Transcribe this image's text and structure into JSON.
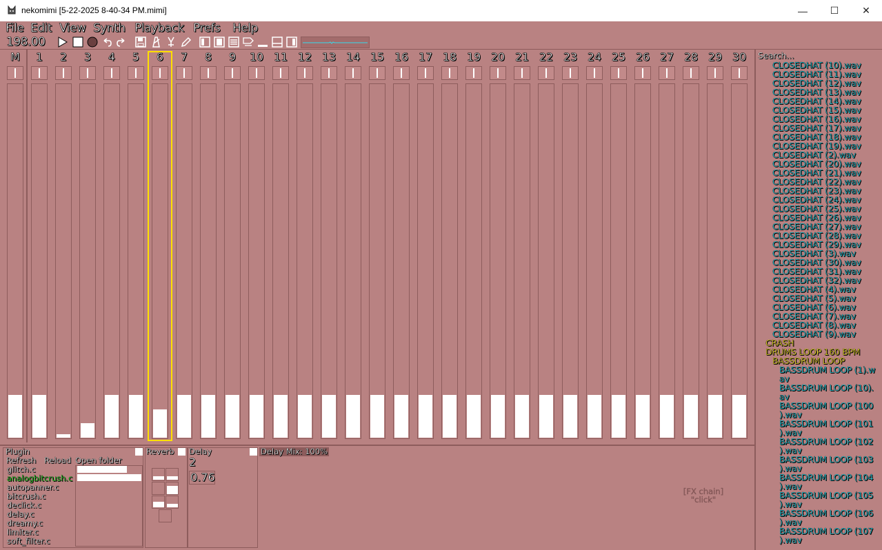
{
  "window": {
    "title": "nekomimi [5-22-2025 8-40-34 PM.mimi]",
    "minimize": "—",
    "maximize": "☐",
    "close": "✕"
  },
  "menu": [
    "File",
    "Edit",
    "View",
    "Synth",
    "Playback",
    "Prefs",
    "Help"
  ],
  "toolbar": {
    "bpm": "198.00",
    "icons": [
      "play-icon",
      "stop-icon",
      "record-icon",
      "undo-icon",
      "redo-icon",
      "save-icon",
      "metronome-icon",
      "tuner-icon",
      "pencil-icon",
      "layout-a-icon",
      "layout-b-icon",
      "layout-c-icon",
      "notes-icon",
      "layout-d-icon",
      "layout-e-icon",
      "layout-f-icon"
    ]
  },
  "mixer": {
    "channels": [
      "M",
      "1",
      "2",
      "3",
      "4",
      "5",
      "6",
      "7",
      "8",
      "9",
      "10",
      "11",
      "12",
      "13",
      "14",
      "15",
      "16",
      "17",
      "18",
      "19",
      "20",
      "21",
      "22",
      "23",
      "24",
      "25",
      "26",
      "27",
      "28",
      "29",
      "30"
    ],
    "levels": [
      0.12,
      0.12,
      0.01,
      0.04,
      0.12,
      0.12,
      0.08,
      0.12,
      0.12,
      0.12,
      0.12,
      0.12,
      0.12,
      0.12,
      0.12,
      0.12,
      0.12,
      0.12,
      0.12,
      0.12,
      0.12,
      0.12,
      0.12,
      0.12,
      0.12,
      0.12,
      0.12,
      0.12,
      0.12,
      0.12,
      0.12
    ],
    "selected_channel": "6"
  },
  "browser": {
    "search_label": "Search...",
    "items": [
      {
        "text": "CLOSEDHAT (10).wav",
        "type": "file",
        "indent": 2
      },
      {
        "text": "CLOSEDHAT (11).wav",
        "type": "file",
        "indent": 2
      },
      {
        "text": "CLOSEDHAT (12).wav",
        "type": "file",
        "indent": 2
      },
      {
        "text": "CLOSEDHAT (13).wav",
        "type": "file",
        "indent": 2
      },
      {
        "text": "CLOSEDHAT (14).wav",
        "type": "file",
        "indent": 2
      },
      {
        "text": "CLOSEDHAT (15).wav",
        "type": "file",
        "indent": 2
      },
      {
        "text": "CLOSEDHAT (16).wav",
        "type": "file",
        "indent": 2
      },
      {
        "text": "CLOSEDHAT (17).wav",
        "type": "file",
        "indent": 2
      },
      {
        "text": "CLOSEDHAT (18).wav",
        "type": "file",
        "indent": 2
      },
      {
        "text": "CLOSEDHAT (19).wav",
        "type": "file",
        "indent": 2
      },
      {
        "text": "CLOSEDHAT (2).wav",
        "type": "file",
        "indent": 2
      },
      {
        "text": "CLOSEDHAT (20).wav",
        "type": "file",
        "indent": 2
      },
      {
        "text": "CLOSEDHAT (21).wav",
        "type": "file",
        "indent": 2
      },
      {
        "text": "CLOSEDHAT (22).wav",
        "type": "file",
        "indent": 2
      },
      {
        "text": "CLOSEDHAT (23).wav",
        "type": "file",
        "indent": 2
      },
      {
        "text": "CLOSEDHAT (24).wav",
        "type": "file",
        "indent": 2
      },
      {
        "text": "CLOSEDHAT (25).wav",
        "type": "file",
        "indent": 2
      },
      {
        "text": "CLOSEDHAT (26).wav",
        "type": "file",
        "indent": 2
      },
      {
        "text": "CLOSEDHAT (27).wav",
        "type": "file",
        "indent": 2
      },
      {
        "text": "CLOSEDHAT (28).wav",
        "type": "file",
        "indent": 2
      },
      {
        "text": "CLOSEDHAT (29).wav",
        "type": "file",
        "indent": 2
      },
      {
        "text": "CLOSEDHAT (3).wav",
        "type": "file",
        "indent": 2
      },
      {
        "text": "CLOSEDHAT (30).wav",
        "type": "file",
        "indent": 2
      },
      {
        "text": "CLOSEDHAT (31).wav",
        "type": "file",
        "indent": 2
      },
      {
        "text": "CLOSEDHAT (32).wav",
        "type": "file",
        "indent": 2
      },
      {
        "text": "CLOSEDHAT (4).wav",
        "type": "file",
        "indent": 2
      },
      {
        "text": "CLOSEDHAT (5).wav",
        "type": "file",
        "indent": 2
      },
      {
        "text": "CLOSEDHAT (6).wav",
        "type": "file",
        "indent": 2
      },
      {
        "text": "CLOSEDHAT (7).wav",
        "type": "file",
        "indent": 2
      },
      {
        "text": "CLOSEDHAT (8).wav",
        "type": "file",
        "indent": 2
      },
      {
        "text": "CLOSEDHAT (9).wav",
        "type": "file",
        "indent": 2
      },
      {
        "text": "CRASH",
        "type": "folder",
        "indent": 1
      },
      {
        "text": "DRUMS LOOP 160 BPM",
        "type": "folder",
        "indent": 1
      },
      {
        "text": "BASSDRUM LOOP",
        "type": "folder",
        "indent": 2
      },
      {
        "text": "BASSDRUM LOOP (1).w",
        "type": "file",
        "indent": 3
      },
      {
        "text": "av",
        "type": "file",
        "indent": 3
      },
      {
        "text": "BASSDRUM LOOP (10).",
        "type": "file",
        "indent": 3
      },
      {
        "text": "av",
        "type": "file",
        "indent": 3
      },
      {
        "text": "BASSDRUM LOOP (100",
        "type": "file",
        "indent": 3
      },
      {
        "text": ").wav",
        "type": "file",
        "indent": 3
      },
      {
        "text": "BASSDRUM LOOP (101",
        "type": "file",
        "indent": 3
      },
      {
        "text": ").wav",
        "type": "file",
        "indent": 3
      },
      {
        "text": "BASSDRUM LOOP (102",
        "type": "file",
        "indent": 3
      },
      {
        "text": ").wav",
        "type": "file",
        "indent": 3
      },
      {
        "text": "BASSDRUM LOOP (103",
        "type": "file",
        "indent": 3
      },
      {
        "text": ").wav",
        "type": "file",
        "indent": 3
      },
      {
        "text": "BASSDRUM LOOP (104",
        "type": "file",
        "indent": 3
      },
      {
        "text": ").wav",
        "type": "file",
        "indent": 3
      },
      {
        "text": "BASSDRUM LOOP (105",
        "type": "file",
        "indent": 3
      },
      {
        "text": ").wav",
        "type": "file",
        "indent": 3
      },
      {
        "text": "BASSDRUM LOOP (106",
        "type": "file",
        "indent": 3
      },
      {
        "text": ").wav",
        "type": "file",
        "indent": 3
      },
      {
        "text": "BASSDRUM LOOP (107",
        "type": "file",
        "indent": 3
      },
      {
        "text": ").wav",
        "type": "file",
        "indent": 3
      }
    ]
  },
  "plugins": {
    "header": "Plugin",
    "refresh": "Refresh",
    "reload": "Reload",
    "open_folder": "Open folder",
    "list": [
      "glitch.c",
      "analogbitcrush.c",
      "autopanner.c",
      "bitcrush.c",
      "declick.c",
      "delay.c",
      "dreamy.c",
      "limiter.c",
      "soft_filter.c"
    ],
    "active_index": 1
  },
  "fx": {
    "reverb_label": "Reverb",
    "delay_label": "Delay",
    "delay_mix_label": "Delay Mix: 100%",
    "delay_param_1": "2",
    "delay_param_2": "0.76",
    "fx_chain_label": "[FX chain]",
    "fx_chain_value": "\"click\""
  }
}
